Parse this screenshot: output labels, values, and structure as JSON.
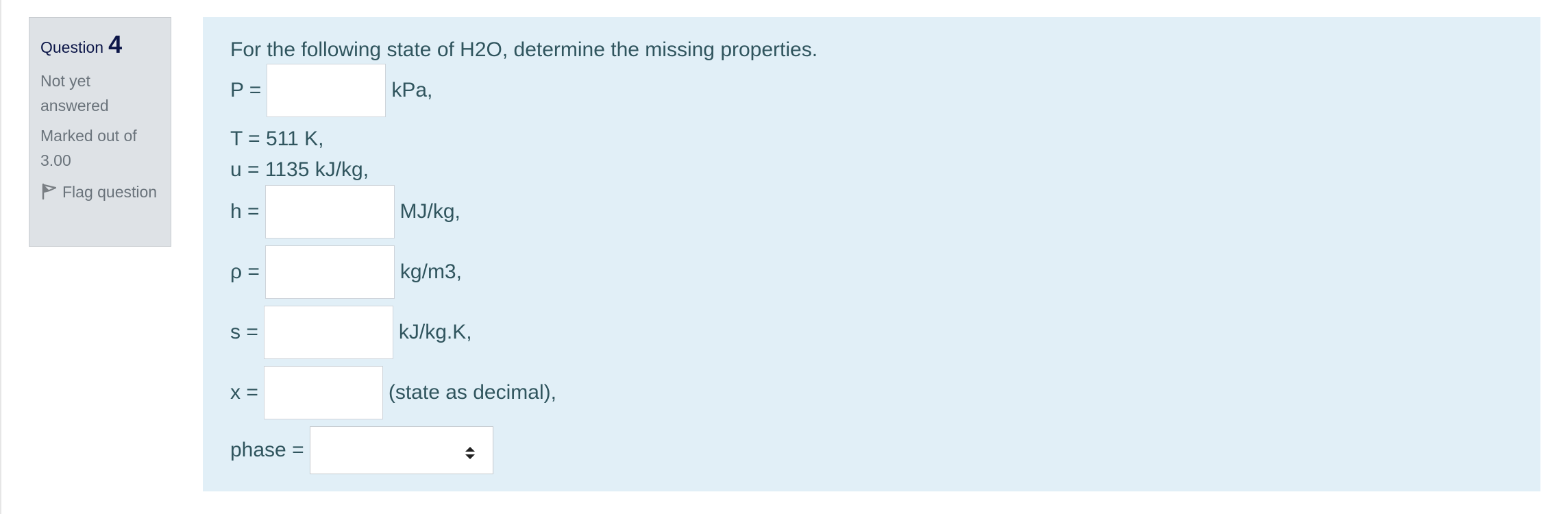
{
  "info": {
    "question_word": "Question",
    "question_number": "4",
    "state": "Not yet answered",
    "grade": "Marked out of 3.00",
    "flag_label": "Flag question"
  },
  "question": {
    "prompt": "For the following state of H2O, determine the missing properties.",
    "pressure": {
      "label": "P =",
      "unit": "kPa,",
      "value": ""
    },
    "temperature_text": "T = 511 K,",
    "internal_energy_text": "u = 1135 kJ/kg,",
    "enthalpy": {
      "label": "h =",
      "unit": "MJ/kg,",
      "value": ""
    },
    "density": {
      "label": "ρ =",
      "unit": "kg/m3,",
      "value": ""
    },
    "entropy": {
      "label": "s =",
      "unit": "kJ/kg.K,",
      "value": ""
    },
    "quality": {
      "label": "x =",
      "unit": "(state as decimal),",
      "value": ""
    },
    "phase": {
      "label": "phase =",
      "selected": ""
    }
  },
  "colors": {
    "info_bg": "#dee2e6",
    "content_bg": "#e1eff7",
    "text": "#30555e",
    "question_number": "#0c1648"
  },
  "icons": {
    "flag": "flag-icon",
    "select_arrows": "select-arrows-icon"
  }
}
